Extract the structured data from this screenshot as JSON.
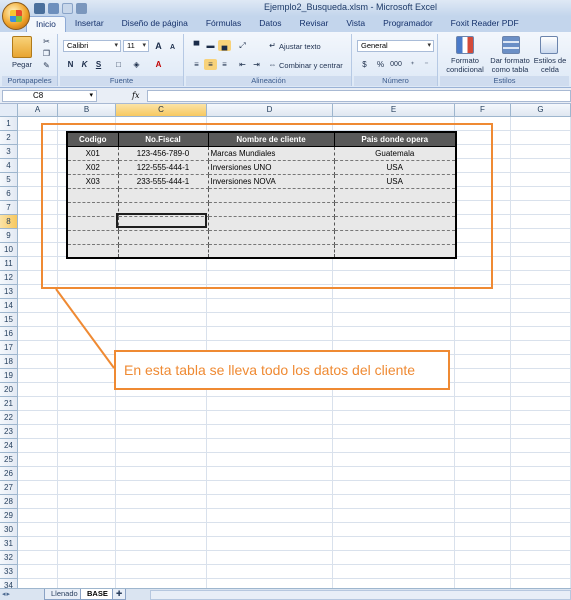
{
  "window": {
    "title": "Ejemplo2_Busqueda.xlsm - Microsoft Excel"
  },
  "tabs": [
    "Inicio",
    "Insertar",
    "Diseño de página",
    "Fórmulas",
    "Datos",
    "Revisar",
    "Vista",
    "Programador",
    "Foxit Reader PDF"
  ],
  "active_tab": "Inicio",
  "ribbon": {
    "clipboard": {
      "paste_label": "Pegar",
      "group_label": "Portapapeles"
    },
    "font": {
      "font_name": "Calibri",
      "font_size": "11",
      "bold": "N",
      "italic": "K",
      "underline": "S",
      "grow": "A",
      "shrink": "A",
      "group_label": "Fuente"
    },
    "alignment": {
      "wrap_text": "Ajustar texto",
      "merge_center": "Combinar y centrar",
      "group_label": "Alineación"
    },
    "number": {
      "format": "General",
      "currency": "$",
      "percent": "%",
      "thousands": "000",
      "group_label": "Número"
    },
    "styles": {
      "conditional": "Formato condicional",
      "format_table": "Dar formato como tabla",
      "cell_styles": "Estilos de celda",
      "group_label": "Estilos"
    }
  },
  "formula_bar": {
    "name_box": "C8",
    "fx_label": "fx",
    "value": ""
  },
  "grid": {
    "columns": [
      "A",
      "B",
      "C",
      "D",
      "E",
      "F",
      "G"
    ],
    "selected_column": "C",
    "rows": [
      "1",
      "2",
      "3",
      "4",
      "5",
      "6",
      "7",
      "8",
      "9",
      "10",
      "11",
      "12",
      "13",
      "14",
      "15",
      "16",
      "17",
      "18",
      "19",
      "20",
      "21",
      "22",
      "23",
      "24",
      "25",
      "26",
      "27",
      "28",
      "29",
      "30",
      "31",
      "32",
      "33",
      "34"
    ],
    "selected_row": "8"
  },
  "table": {
    "headers": [
      "Codigo",
      "No.Fiscal",
      "Nombre de cliente",
      "Pais donde opera"
    ],
    "rows": [
      [
        "X01",
        "123-456-789-0",
        "Marcas Mundiales",
        "Guatemala"
      ],
      [
        "X02",
        "122-555-444-1",
        "Inversiones UNO",
        "USA"
      ],
      [
        "X03",
        "233-555-444-1",
        "Inversiones NOVA",
        "USA"
      ],
      [
        "",
        "",
        "",
        ""
      ],
      [
        "",
        "",
        "",
        ""
      ],
      [
        "",
        "",
        "",
        ""
      ],
      [
        "",
        "",
        "",
        ""
      ],
      [
        "",
        "",
        "",
        ""
      ]
    ]
  },
  "annotation": {
    "text": "En esta tabla se lleva todo los datos del cliente",
    "color": "#ef8a33"
  },
  "sheets": [
    "Llenado",
    "BASE"
  ],
  "active_sheet": "BASE"
}
